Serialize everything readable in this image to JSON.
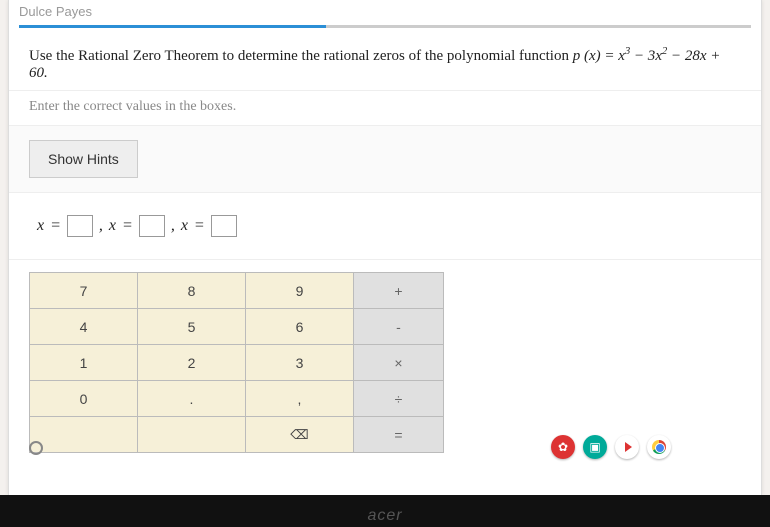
{
  "header": {
    "student_name": "Dulce Payes"
  },
  "question": {
    "prefix": "Use the Rational Zero Theorem to determine the rational zeros of the polynomial function ",
    "poly_lhs": "p (x) = ",
    "poly_rhs_html": "x³ − 3x² − 28x + 60."
  },
  "instruction": "Enter the correct values in the boxes.",
  "hints": {
    "button_label": "Show Hints"
  },
  "answer": {
    "var": "x",
    "eq": "=",
    "sep": ","
  },
  "keypad": {
    "rows": [
      [
        "7",
        "8",
        "9",
        "+"
      ],
      [
        "4",
        "5",
        "6",
        "-"
      ],
      [
        "1",
        "2",
        "3",
        "×"
      ],
      [
        "0",
        ".",
        ",",
        "÷"
      ],
      [
        "",
        "",
        "⌫",
        "="
      ]
    ]
  },
  "shelf": {
    "icons": [
      "screencast",
      "present",
      "play",
      "chrome"
    ]
  },
  "brand": "acer"
}
